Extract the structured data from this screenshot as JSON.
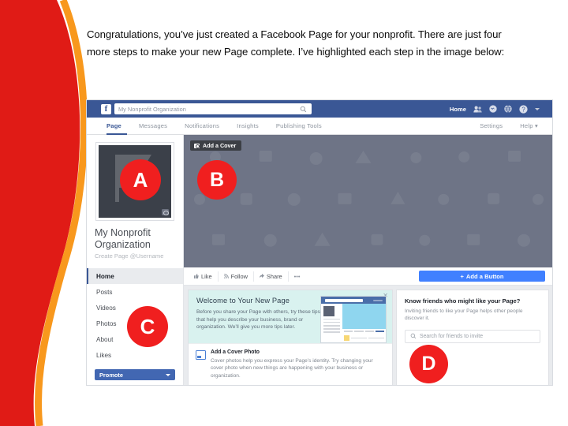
{
  "slide": {
    "intro_paragraph": "Congratulations, you’ve just created a Facebook Page for your nonprofit. There are just four more steps to make your new Page complete. I’ve highlighted each step in the image below:"
  },
  "colors": {
    "swoosh_red": "#e01b16",
    "swoosh_orange": "#f8981d",
    "badge_red": "#f01f1f",
    "facebook_blue": "#3a5795",
    "button_blue": "#4080ff",
    "promote_blue": "#4267b2",
    "cover_gray": "#6e7486",
    "welcome_teal": "#d9f2ef"
  },
  "screenshot": {
    "topbar": {
      "logo": "f",
      "search_value": "My Nonprofit Organization",
      "search_icon": "search-icon",
      "home_label": "Home",
      "icons": [
        "friend-requests-icon",
        "messenger-icon",
        "globe-notifications-icon",
        "help-icon"
      ],
      "caret": "chevron-down-icon"
    },
    "tabs": {
      "items": [
        "Page",
        "Messages",
        "Notifications",
        "Insights",
        "Publishing Tools"
      ],
      "active": "Page",
      "right_items": [
        "Settings",
        "Help"
      ],
      "help_caret": "chevron-down-icon"
    },
    "profile": {
      "page_name": "My Nonprofit\nOrganization",
      "username_line": "Create Page @Username",
      "avatar_icon": "page-avatar",
      "avatar_camera_icon": "camera-icon"
    },
    "sidebar": {
      "items": [
        "Home",
        "Posts",
        "Videos",
        "Photos",
        "About",
        "Likes"
      ],
      "active": "Home",
      "promote_label": "Promote",
      "promote_caret": "chevron-down-icon"
    },
    "cover": {
      "add_cover_label": "Add a Cover",
      "add_cover_icon": "camera-icon"
    },
    "actionbar": {
      "like_label": "Like",
      "like_icon": "thumbs-up-icon",
      "follow_label": "Follow",
      "follow_icon": "rss-follow-icon",
      "share_label": "Share",
      "share_icon": "share-arrow-icon",
      "more_label": "•••",
      "add_button_label": "Add a Button",
      "add_button_plus": "+"
    },
    "welcome_card": {
      "title": "Welcome to Your New Page",
      "body": "Before you share your Page with others, try these tips that help you describe your business, brand or organization. We’ll give you more tips later.",
      "close_icon": "close-icon",
      "illustration": "page-preview-illustration",
      "item_title": "Add a Cover Photo",
      "item_icon": "photo-icon",
      "item_body": "Cover photos help you express your Page’s identity. Try changing your cover photo when new things are happening with your business or organization."
    },
    "friends_card": {
      "title": "Know friends who might like your Page?",
      "body": "Inviting friends to like your Page helps other people discover it.",
      "search_placeholder": "Search for friends to invite",
      "search_icon": "search-icon"
    },
    "callouts": [
      {
        "id": "a",
        "label": "A"
      },
      {
        "id": "b",
        "label": "B"
      },
      {
        "id": "c",
        "label": "C"
      },
      {
        "id": "d",
        "label": "D"
      }
    ]
  }
}
